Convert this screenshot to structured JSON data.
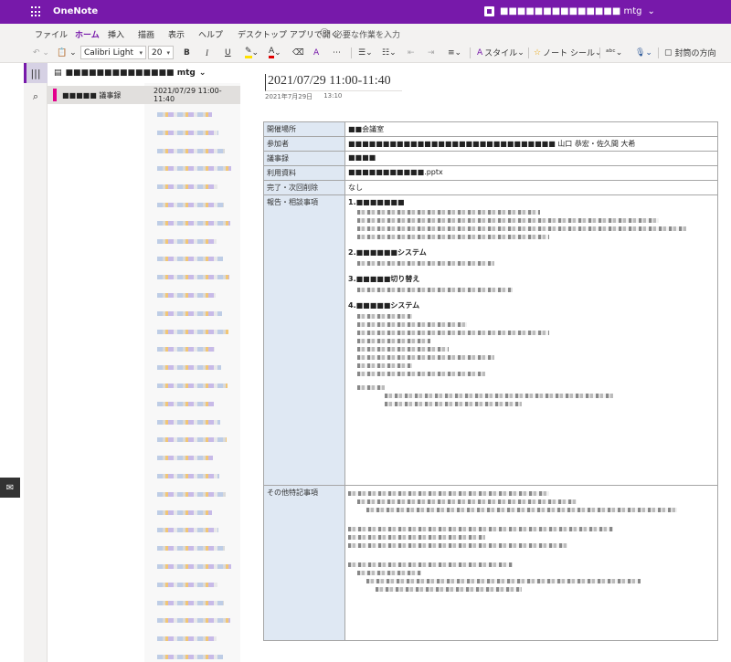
{
  "app": {
    "name": "OneNote",
    "document_title": "■■■■■■■■■■■■■■ mtg"
  },
  "menu": {
    "tabs": [
      "ファイル",
      "ホーム",
      "挿入",
      "描画",
      "表示",
      "ヘルプ",
      "デスクトップ アプリで開く"
    ],
    "active_tab": "ホーム",
    "search_placeholder": "必要な作業を入力"
  },
  "toolbar": {
    "font_name": "Calibri Light",
    "font_size": "20",
    "bold": "B",
    "italic": "I",
    "underline": "U",
    "style_label": "スタイル",
    "tags_label": "ノート シール",
    "envelope_label": "封筒の方向"
  },
  "notebook": {
    "name": "■■■■■■■■■■■■■■ mtg"
  },
  "section": {
    "name": "■■■■■ 議事録"
  },
  "pages": {
    "active_title": "2021/07/29 11:00-11:40"
  },
  "page": {
    "title": "2021/07/29 11:00-11:40",
    "date": "2021年7月29日",
    "time": "13:10"
  },
  "table": {
    "rows": [
      {
        "key": "開催場所",
        "value": "■■会議室"
      },
      {
        "key": "参加者",
        "value": "■■■■■■■■■■■■■■■■■■■■■■■■■■■■■■ 山口 恭宏・佐久間 大希"
      },
      {
        "key": "議事録",
        "value": "■■■■"
      },
      {
        "key": "利用資料",
        "value": "■■■■■■■■■■■.pptx"
      },
      {
        "key": "完了・次回削除",
        "value": "なし"
      }
    ],
    "report": {
      "key": "報告・相談事項",
      "headings": [
        "1.■■■■■■■",
        "2.■■■■■■システム",
        "3.■■■■■切り替え",
        "4.■■■■■システム"
      ]
    },
    "other": {
      "key": "その他特記事項"
    }
  },
  "colors": {
    "brand": "#7719aa",
    "table_key_bg": "#dfe8f3",
    "section_tab": "#e3008c"
  }
}
